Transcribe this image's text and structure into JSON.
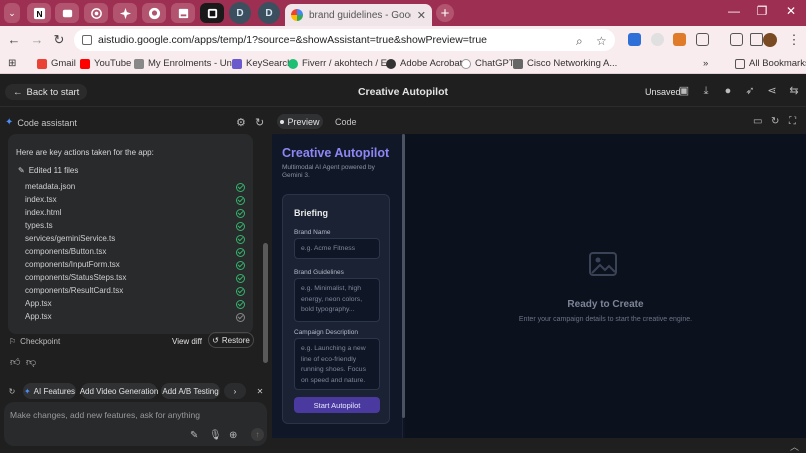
{
  "browser": {
    "pinned_tabs": [
      "D",
      "D"
    ],
    "active_tab_title": "brand guidelines - Google Sear",
    "url": "aistudio.google.com/apps/temp/1?source=&showAssistant=true&showPreview=true",
    "bookmarks": [
      "Gmail",
      "YouTube",
      "My Enrolments - Un...",
      "KeySearch",
      "Fiverr / akohtech / E...",
      "Adobe Acrobat",
      "ChatGPT",
      "Cisco Networking A..."
    ],
    "all_bookmarks": "All Bookmarks"
  },
  "header": {
    "back_label": "Back to start",
    "title": "Creative Autopilot",
    "unsaved": "Unsaved"
  },
  "assistant": {
    "title": "Code assistant",
    "intro": "Here are key actions taken for the app:",
    "edited": "Edited 11 files",
    "files": [
      {
        "name": "metadata.json",
        "status": "done"
      },
      {
        "name": "index.tsx",
        "status": "done"
      },
      {
        "name": "index.html",
        "status": "done"
      },
      {
        "name": "types.ts",
        "status": "done"
      },
      {
        "name": "services/geminiService.ts",
        "status": "done"
      },
      {
        "name": "components/Button.tsx",
        "status": "done"
      },
      {
        "name": "components/InputForm.tsx",
        "status": "done"
      },
      {
        "name": "components/StatusSteps.tsx",
        "status": "done"
      },
      {
        "name": "components/ResultCard.tsx",
        "status": "done"
      },
      {
        "name": "App.tsx",
        "status": "done"
      },
      {
        "name": "App.tsx",
        "status": "pending"
      }
    ],
    "checkpoint": "Checkpoint",
    "view_diff": "View diff",
    "restore": "Restore",
    "chips": [
      "AI Features",
      "Add Video Generation",
      "Add A/B Testing"
    ],
    "input_placeholder": "Make changes, add new features, ask for anything"
  },
  "preview_tabs": {
    "preview": "Preview",
    "code": "Code"
  },
  "app": {
    "brand": "Creative Autopilot",
    "subtitle": "Multimodal AI Agent powered by Gemini 3.",
    "briefing": "Briefing",
    "brand_name_label": "Brand Name",
    "brand_name_placeholder": "e.g. Acme Fitness",
    "guidelines_label": "Brand Guidelines",
    "guidelines_placeholder": "e.g. Minimalist, high energy, neon colors, bold typography...",
    "campaign_label": "Campaign Description",
    "campaign_placeholder": "e.g. Launching a new line of eco-friendly running shoes. Focus on speed and nature.",
    "start_button": "Start Autopilot",
    "ready_title": "Ready to Create",
    "ready_sub": "Enter your campaign details to start the creative engine."
  },
  "colors": {
    "tab_strip": "#9d2f52",
    "brand_accent": "#8e86f5",
    "start_button": "#4a3aa0",
    "check_green": "#35b36b"
  }
}
